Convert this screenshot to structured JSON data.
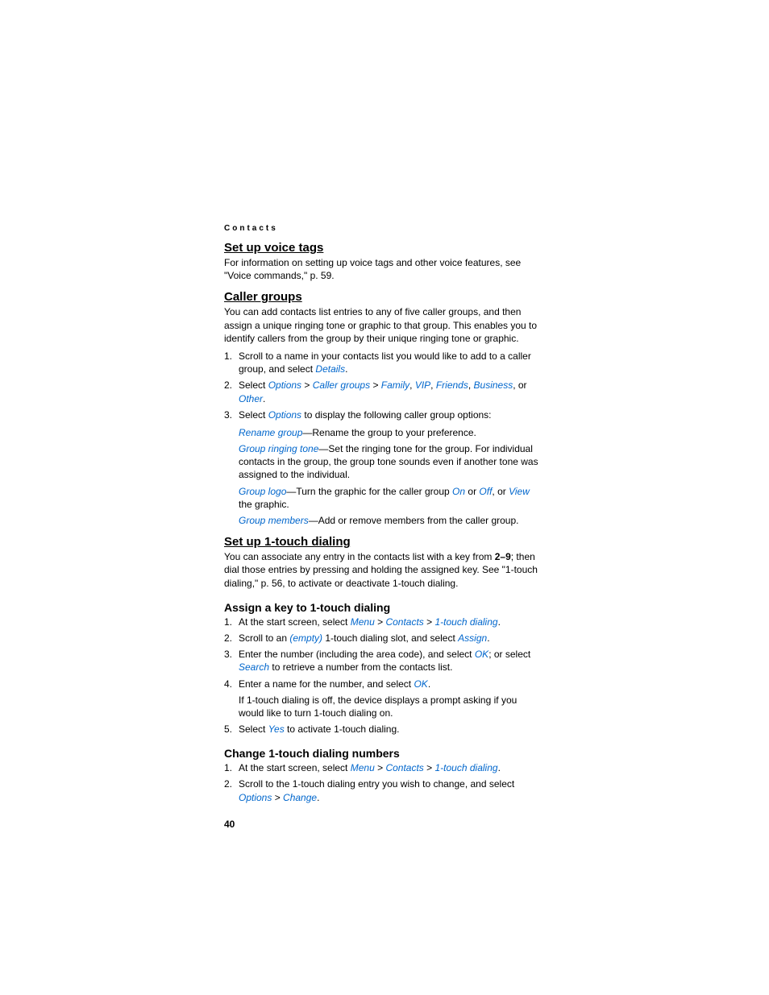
{
  "header": {
    "section": "Contacts"
  },
  "s1": {
    "title": "Set up voice tags",
    "para": "For information on setting up voice tags and other voice features, see \"Voice commands,\" p. 59."
  },
  "s2": {
    "title": "Caller groups",
    "intro": "You can add contacts list entries to any of five caller groups, and then assign a unique ringing tone or graphic to that group. This enables you to identify callers from the group by their unique ringing tone or graphic.",
    "step1a": "Scroll to a name in your contacts list you would like to add to a caller group, and select ",
    "details": "Details",
    "step2a": "Select ",
    "options": "Options",
    "callergroups": "Caller groups",
    "family": "Family",
    "vip": "VIP",
    "friends": "Friends",
    "business": "Business",
    "step2b": ", or ",
    "other": "Other",
    "step3a": "Select ",
    "step3b": " to display the following caller group options:",
    "rename": "Rename group",
    "rename_t": "—Rename the group to your preference.",
    "ringtone": "Group ringing tone",
    "ringtone_t": "—Set the ringing tone for the group. For individual contacts in the group, the group tone sounds even if another tone was assigned to the individual.",
    "logo": "Group logo",
    "logo_t1": "—Turn the graphic for the caller group ",
    "on": "On",
    "logo_t2": " or ",
    "off": "Off",
    "logo_t3": ", or ",
    "view": "View",
    "logo_t4": " the graphic.",
    "members": "Group members",
    "members_t": "—Add or remove members from the caller group."
  },
  "s3": {
    "title": "Set up 1-touch dialing",
    "intro1": "You can associate any entry in the contacts list with a key from ",
    "keys": "2–9",
    "intro2": "; then dial those entries by pressing and holding the assigned key. See \"1-touch dialing,\" p. 56, to activate or deactivate 1-touch dialing.",
    "sub1_title": "Assign a key to 1-touch dialing",
    "a1a": "At the start screen, select ",
    "menu": "Menu",
    "contacts": "Contacts",
    "onetouch": "1-touch dialing",
    "a2a": "Scroll to an ",
    "empty": "(empty)",
    "a2b": " 1-touch dialing slot, and select ",
    "assign": "Assign",
    "a3a": "Enter the number (including the area code), and select ",
    "ok": "OK",
    "a3b": "; or select ",
    "search": "Search",
    "a3c": " to retrieve a number from the contacts list.",
    "a4a": "Enter a name for the number, and select ",
    "a4_follow": "If 1-touch dialing is off, the device displays a prompt asking if you would like to turn 1-touch dialing on.",
    "a5a": "Select ",
    "yes": "Yes",
    "a5b": " to activate 1-touch dialing.",
    "sub2_title": "Change 1-touch dialing numbers",
    "c1a": "At the start screen, select ",
    "c2a": "Scroll to the 1-touch dialing entry you wish to change, and select ",
    "options": "Options",
    "change": "Change"
  },
  "pagenum": "40"
}
